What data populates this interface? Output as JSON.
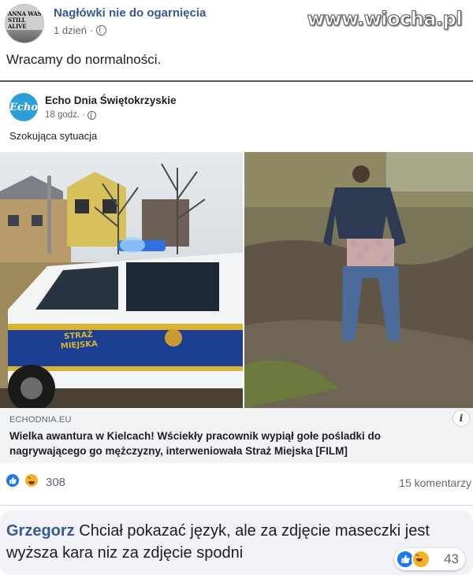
{
  "post": {
    "group_name": "Nagłówki nie do ogarnięcia",
    "time": "1 dzień",
    "separator": "·",
    "avatar_text": "ANNA WAS STILL ALIVE HOURS BEFORE SHE DIED",
    "watermark": "www.wiocha.pl",
    "text": "Wracamy do normalności."
  },
  "shared": {
    "page_name": "Echo Dnia Świętokrzyskie",
    "page_avatar_text": "Echo",
    "time": "18 godz.",
    "separator": "·",
    "text": "Szokująca sytuacja",
    "van_label_line1": "STRAŻ",
    "van_label_line2": "MIEJSKA",
    "link_domain": "ECHODNIA.EU",
    "link_title": "Wielka awantura w Kielcach! Wściekły pracownik wypiął gołe pośladki do nagrywającego go mężczyzny, interweniowała Straż Miejska [FILM]",
    "info_glyph": "i"
  },
  "reactions": {
    "icons": [
      "like-icon",
      "haha-icon"
    ],
    "count": "308",
    "comments": "15 komentarzy"
  },
  "comment": {
    "author": "Grzegorz",
    "text": "Chciał pokazać język, ale za zdjęcie maseczki jest wyższa kara niz za zdjęcie spodni",
    "reaction_icons": [
      "like-icon",
      "haha-icon"
    ],
    "reaction_count": "43"
  },
  "colors": {
    "link_blue": "#385898",
    "like_blue": "#1877f2",
    "haha_yellow": "#f7b125",
    "van_blue": "#1c3f94"
  }
}
